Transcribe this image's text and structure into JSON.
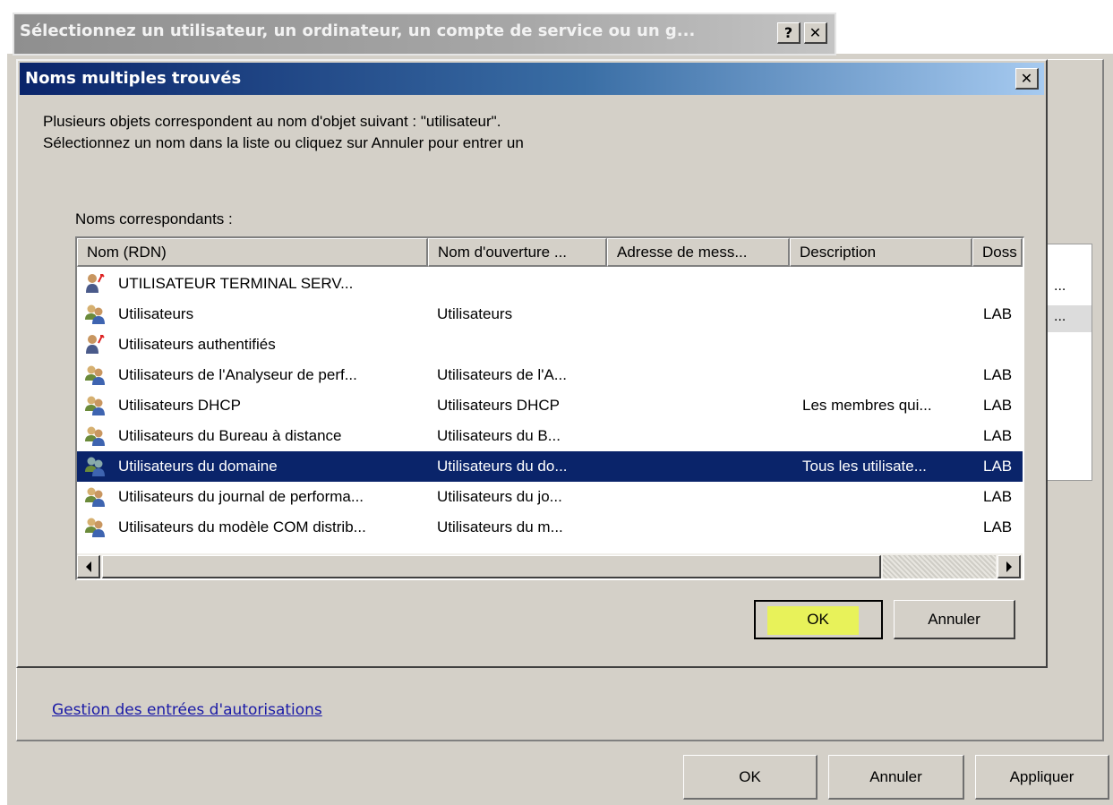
{
  "colors": {
    "title_active": "#0a246a",
    "selection": "#0a246a",
    "dialog_face": "#d4d0c8",
    "highlight_marker": "#e8f25a",
    "link": "#1a1aa6"
  },
  "select_dialog": {
    "title": "Sélectionnez un utilisateur, un ordinateur, un compte de service ou un g...",
    "help_label": "?",
    "close_label": "✕"
  },
  "dialog": {
    "title": "Noms multiples trouvés",
    "close_label": "✕",
    "message_line1": "Plusieurs objets correspondent au nom d'objet suivant : \"utilisateur\".",
    "message_line2": "Sélectionnez un nom dans la liste ou cliquez sur Annuler pour entrer un",
    "group_label": "Noms correspondants :",
    "columns": [
      "Nom (RDN)",
      "Nom d'ouverture ...",
      "Adresse de mess...",
      "Description",
      "Doss"
    ],
    "rows": [
      {
        "icon": "special-user-icon",
        "name": "UTILISATEUR TERMINAL SERV...",
        "login": "",
        "email": "",
        "description": "",
        "folder": ""
      },
      {
        "icon": "group-icon",
        "name": "Utilisateurs",
        "login": "Utilisateurs",
        "email": "",
        "description": "",
        "folder": "LAB"
      },
      {
        "icon": "special-user-icon",
        "name": "Utilisateurs authentifiés",
        "login": "",
        "email": "",
        "description": "",
        "folder": ""
      },
      {
        "icon": "group-icon",
        "name": "Utilisateurs de l'Analyseur de perf...",
        "login": "Utilisateurs de l'A...",
        "email": "",
        "description": "",
        "folder": "LAB"
      },
      {
        "icon": "group-icon",
        "name": "Utilisateurs DHCP",
        "login": "Utilisateurs DHCP",
        "email": "",
        "description": "Les membres qui...",
        "folder": "LAB"
      },
      {
        "icon": "group-icon",
        "name": "Utilisateurs du Bureau à distance",
        "login": "Utilisateurs du B...",
        "email": "",
        "description": "",
        "folder": "LAB"
      },
      {
        "icon": "group-icon",
        "name": "Utilisateurs du domaine",
        "login": "Utilisateurs du do...",
        "email": "",
        "description": "Tous les utilisate...",
        "folder": "LAB",
        "selected": true
      },
      {
        "icon": "group-icon",
        "name": "Utilisateurs du journal de performa...",
        "login": "Utilisateurs du jo...",
        "email": "",
        "description": "",
        "folder": "LAB"
      },
      {
        "icon": "group-icon",
        "name": "Utilisateurs du modèle COM distrib...",
        "login": "Utilisateurs du m...",
        "email": "",
        "description": "",
        "folder": "LAB"
      }
    ],
    "ok_label": "OK",
    "cancel_label": "Annuler"
  },
  "background": {
    "overflow_dots": "...",
    "link": "Gestion des entrées d'autorisations",
    "ok_label": "OK",
    "cancel_label": "Annuler",
    "apply_label": "Appliquer"
  }
}
